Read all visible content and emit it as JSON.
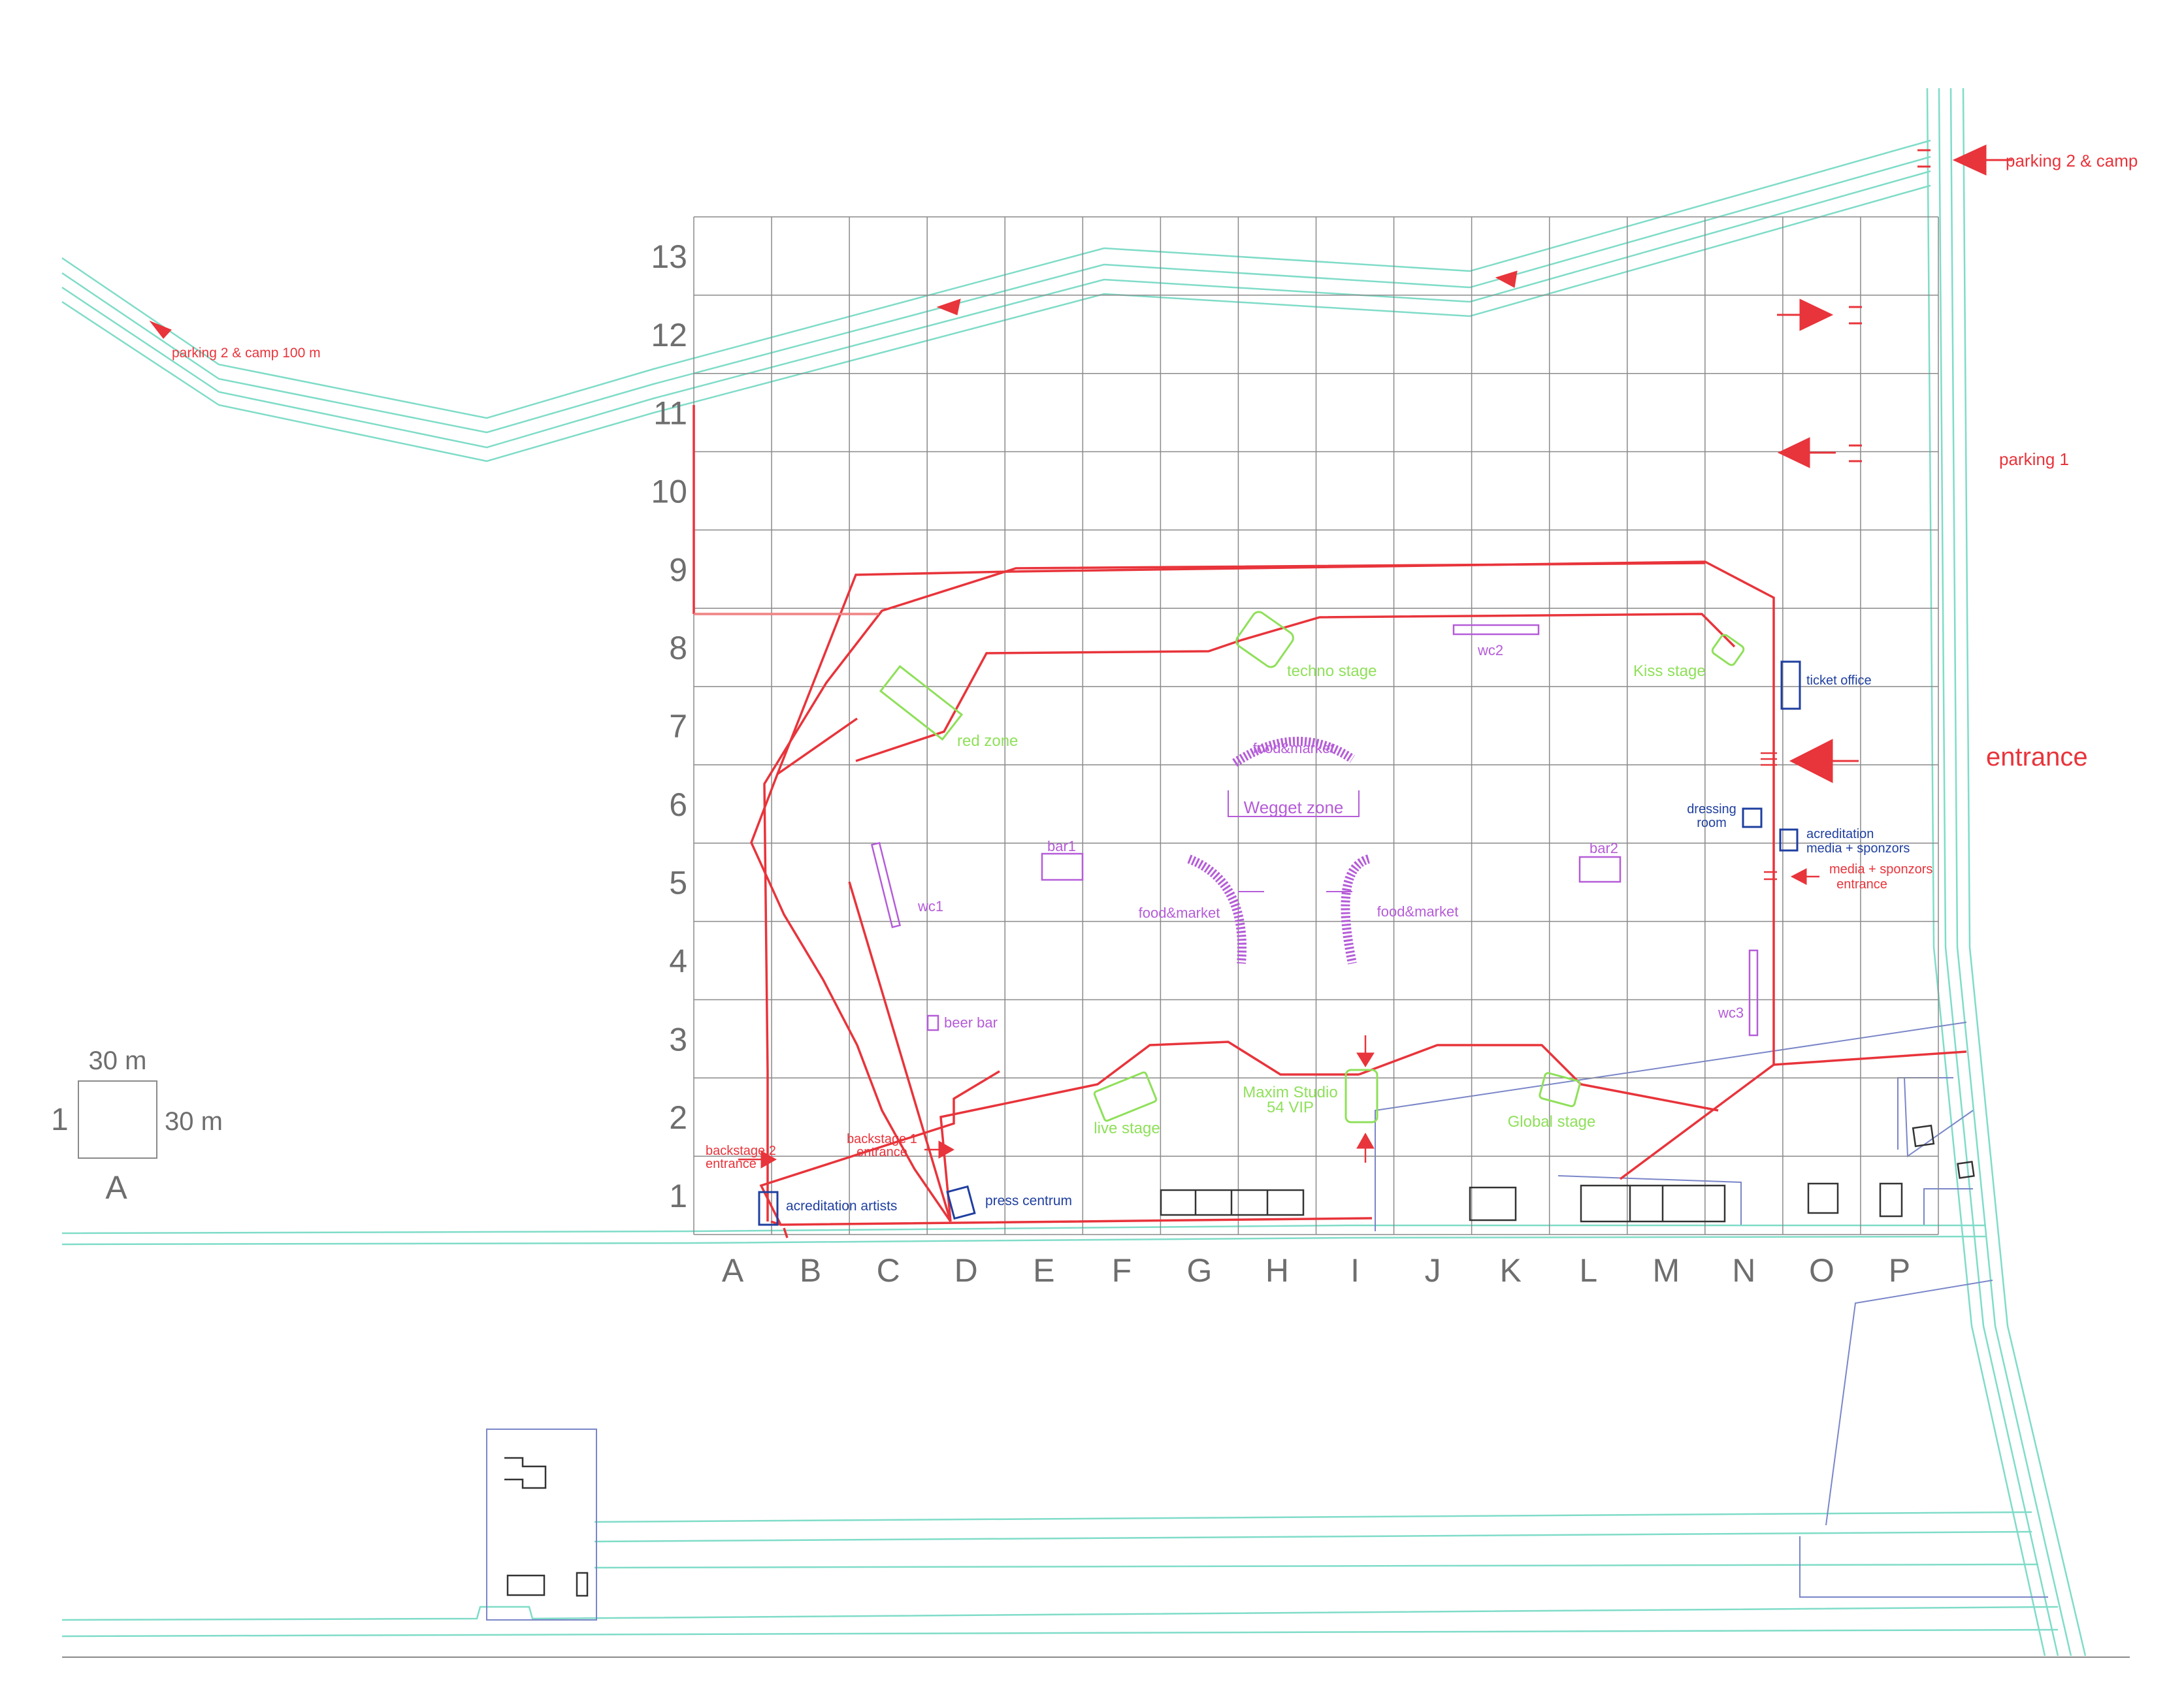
{
  "grid": {
    "columns": [
      "A",
      "B",
      "C",
      "D",
      "E",
      "F",
      "G",
      "H",
      "I",
      "J",
      "K",
      "L",
      "M",
      "N",
      "O",
      "P"
    ],
    "rows": [
      "13",
      "12",
      "11",
      "10",
      "9",
      "8",
      "7",
      "6",
      "5",
      "4",
      "3",
      "2",
      "1"
    ]
  },
  "scale": {
    "width": "30 m",
    "height": "30 m",
    "row": "1",
    "column": "A"
  },
  "labels": {
    "parking_top": "parking 2 & camp",
    "parking_left": "parking 2 & camp 100 m",
    "parking1": "parking 1",
    "entrance": "entrance",
    "techno_stage": "techno stage",
    "kiss_stage": "Kiss stage",
    "red_zone": "red zone",
    "wc1": "wc1",
    "wc2": "wc2",
    "wc3": "wc3",
    "food_top": "food&market",
    "food_left": "food&market",
    "food_right": "food&market",
    "wegget": "Wegget zone",
    "bar1": "bar1",
    "bar2": "bar2",
    "beer_bar": "beer bar",
    "live_stage": "live stage",
    "maxim_1": "Maxim Studio",
    "maxim_2": "54 VIP",
    "global_stage": "Global stage",
    "ticket_office": "ticket office",
    "dressing_1": "dressing",
    "dressing_2": "room",
    "acred_media_1": "acreditation",
    "acred_media_2": "media + sponzors",
    "media_entr_1": "media + sponzors",
    "media_entr_2": "entrance",
    "backstage2_1": "backstage 2",
    "backstage2_2": "entrance",
    "backstage1_1": "backstage 1",
    "backstage1_2": "entrance",
    "acred_artists": "acreditation artists",
    "press": "press centrum"
  },
  "colors": {
    "grid": "#8a8a8a",
    "road": "#7fdcc8",
    "fence": "#e8343b",
    "stage": "#8fe05a",
    "facility": "#b55cd8",
    "office": "#1f3fa0",
    "building": "#333333"
  }
}
